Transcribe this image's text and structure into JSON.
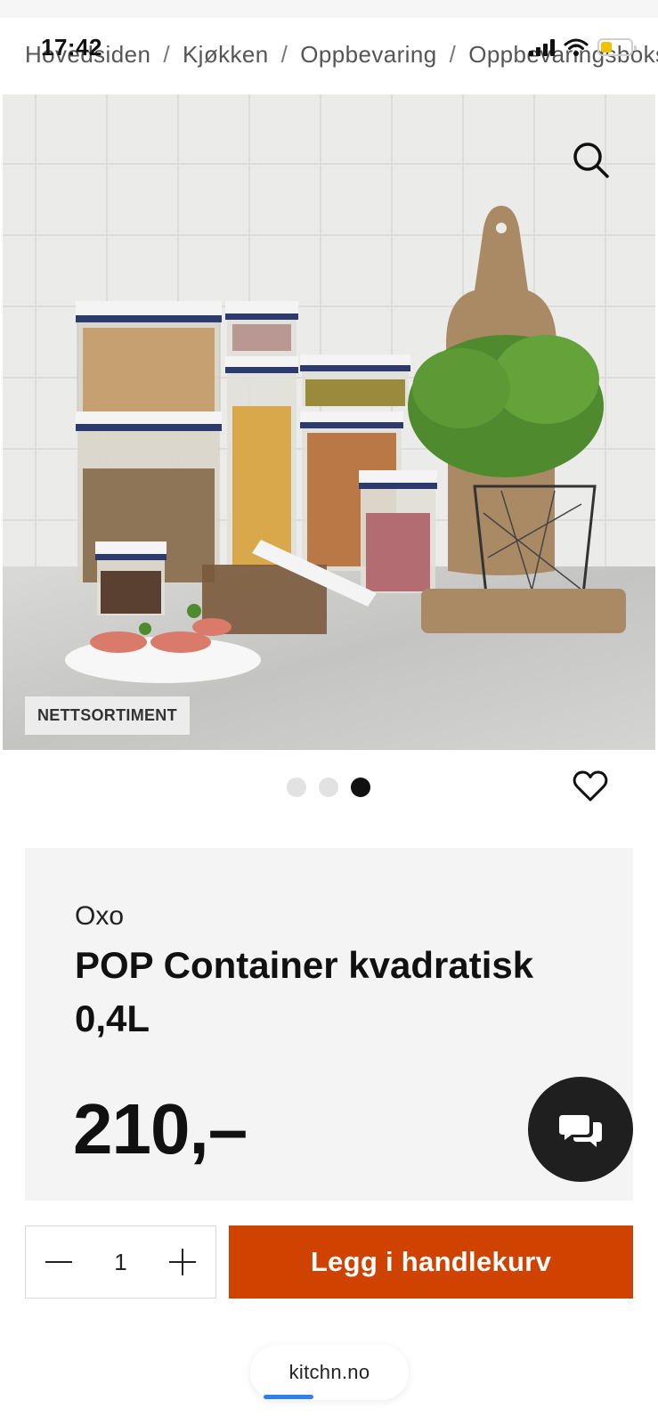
{
  "status": {
    "time": "17:42"
  },
  "breadcrumb": [
    "Hovedsiden",
    "Kjøkken",
    "Oppbevaring",
    "Oppbevaringsbokser"
  ],
  "hero": {
    "badge": "NETTSORTIMENT",
    "slides_count": 3,
    "active_slide": 3
  },
  "product": {
    "brand": "Oxo",
    "title": "POP Container kvadratisk 0,4L",
    "price": "210,–"
  },
  "cart": {
    "quantity": "1",
    "add_label": "Legg i handlekurv",
    "accent": "#d04200"
  },
  "browser": {
    "url": "kitchn.no"
  }
}
